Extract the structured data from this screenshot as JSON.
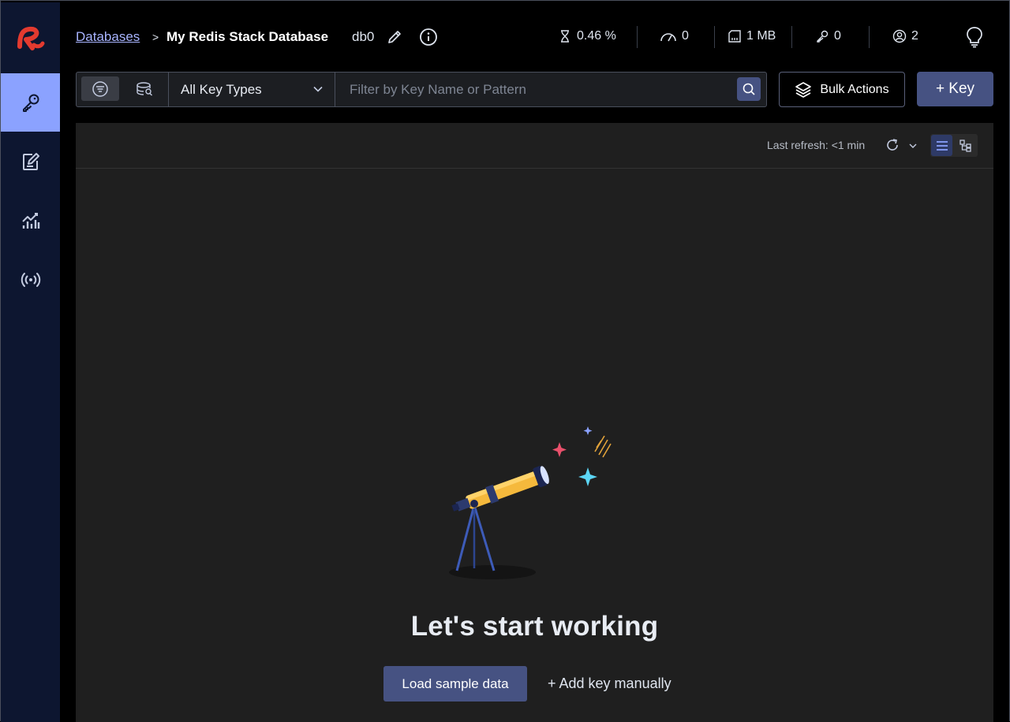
{
  "sidebar": {
    "logo": "redis-logo",
    "items": [
      {
        "name": "browser",
        "icon": "key-icon",
        "active": true
      },
      {
        "name": "workbench",
        "icon": "edit-icon",
        "active": false
      },
      {
        "name": "analysis",
        "icon": "chart-icon",
        "active": false
      },
      {
        "name": "pubsub",
        "icon": "broadcast-icon",
        "active": false
      }
    ]
  },
  "header": {
    "breadcrumb_link": "Databases",
    "breadcrumb_sep": ">",
    "db_name": "My Redis Stack Database",
    "db_index": "db0",
    "stats": {
      "cpu": "0.46 %",
      "ops": "0",
      "memory": "1 MB",
      "keys": "0",
      "clients": "2"
    }
  },
  "toolbar": {
    "key_type": "All Key Types",
    "filter_placeholder": "Filter by Key Name or Pattern",
    "filter_value": "",
    "bulk_actions": "Bulk Actions",
    "add_key": "+ Key"
  },
  "panel": {
    "last_refresh": "Last refresh: <1 min",
    "empty_title": "Let's start working",
    "load_sample": "Load sample data",
    "add_manually": "+ Add key manually"
  },
  "colors": {
    "accent": "#465282",
    "active_nav": "#8ba2ff",
    "brand_red": "#e33a2f",
    "sidebar_bg": "#0d1630",
    "link": "#a8b4ff"
  }
}
